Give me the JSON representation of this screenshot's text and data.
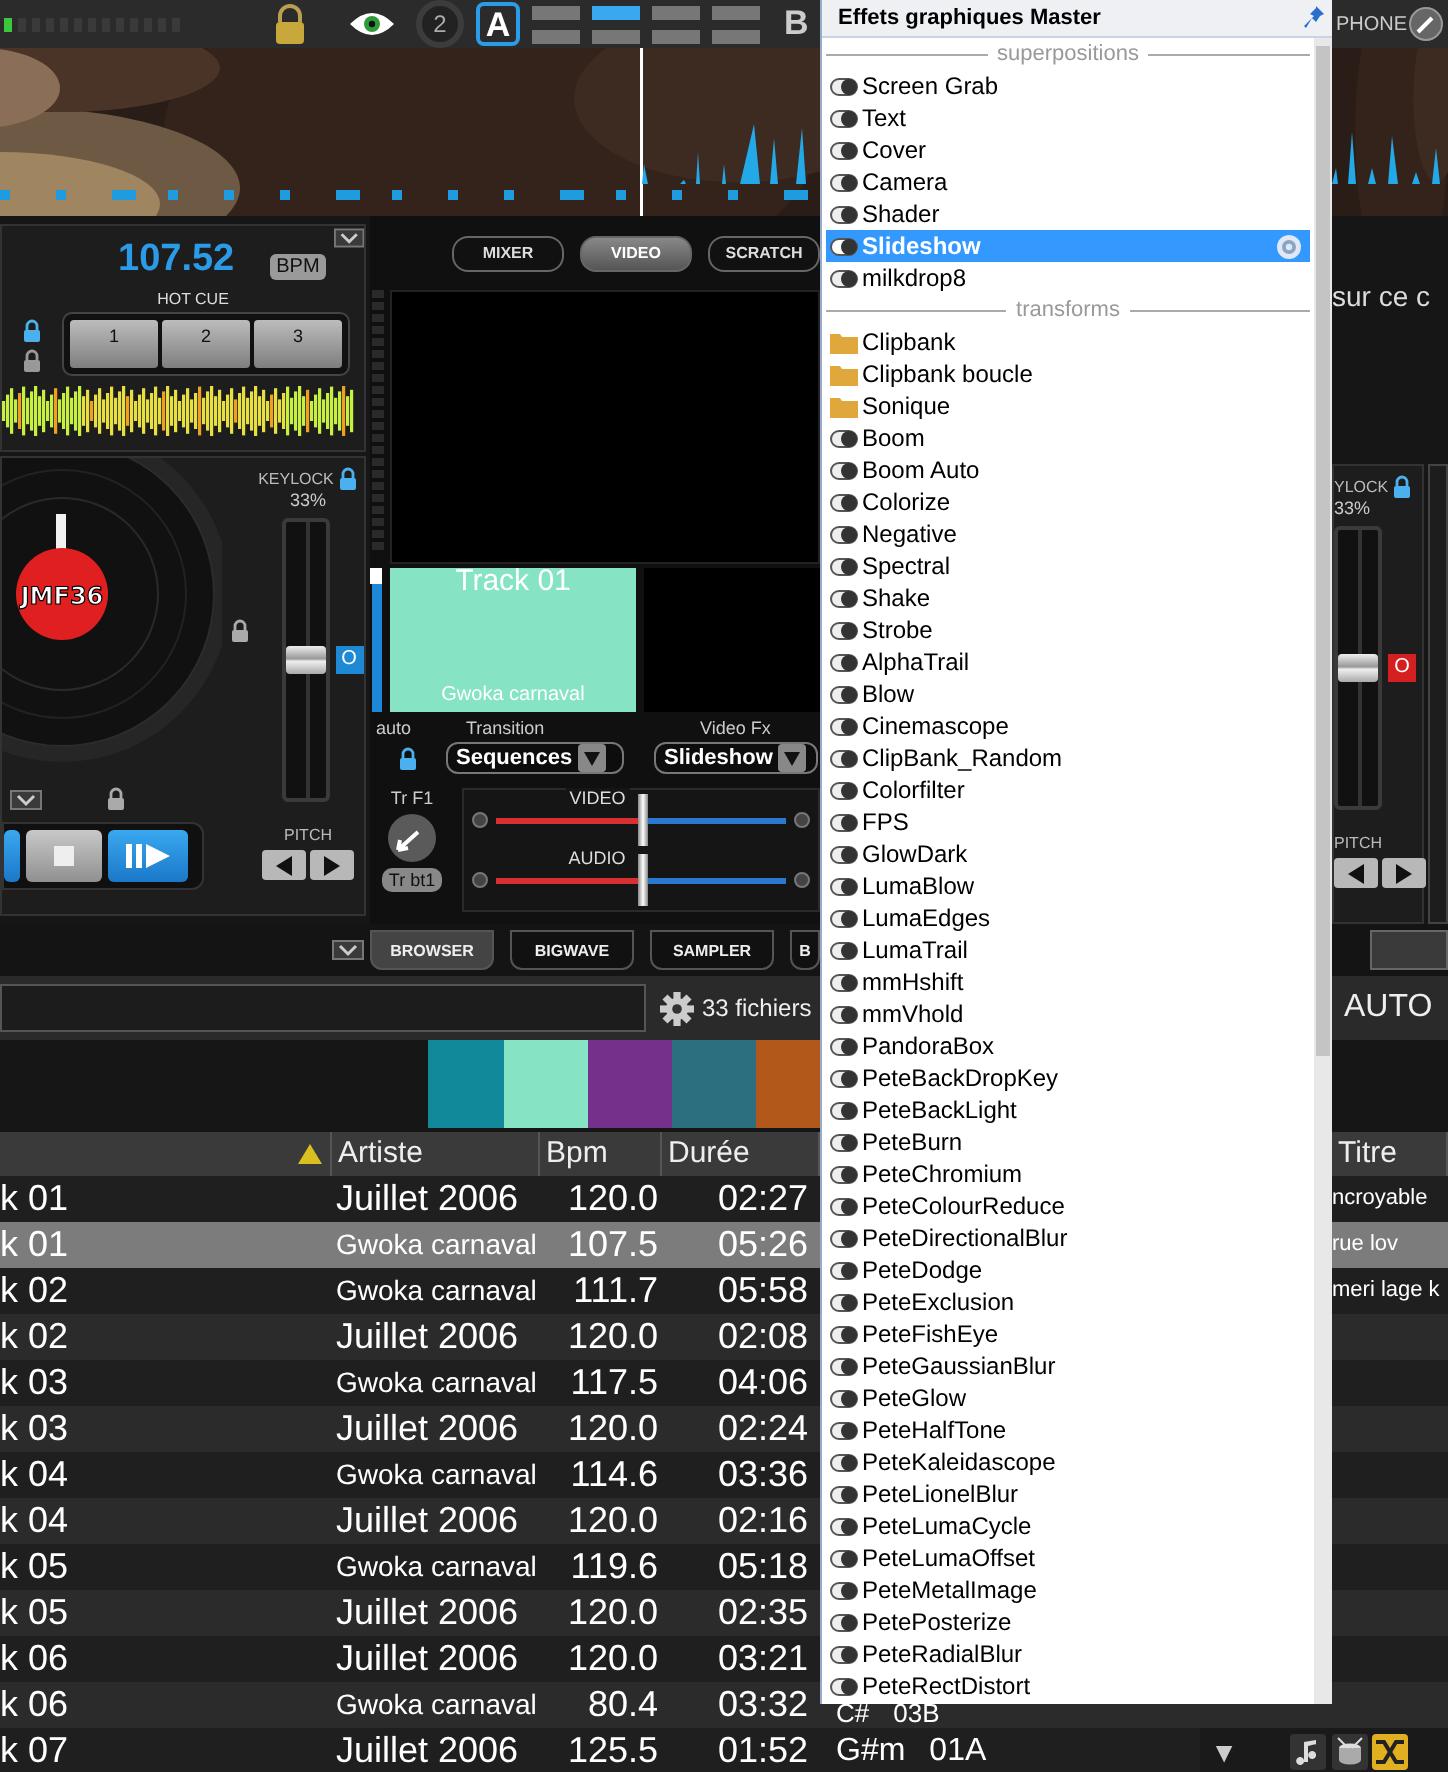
{
  "top_bar": {
    "deck_count": "2",
    "active_deck": "A",
    "other_deck": "B",
    "layouts": [
      {
        "selected": false
      },
      {
        "selected": true
      },
      {
        "selected": false
      },
      {
        "selected": false
      }
    ],
    "output_label": "PHONE"
  },
  "left_deck": {
    "bpm": "107.52",
    "bpm_button": "BPM",
    "hot_cue_label": "HOT CUE",
    "cue_buttons": [
      "1",
      "2",
      "3"
    ],
    "platter_label": "JMF36",
    "keylock_label": "KEYLOCK",
    "keylock_value": "33%",
    "pitch": {
      "level": 0.5
    },
    "sync_button": {
      "label": "O",
      "color": "#1e8ad6"
    },
    "pitch_label": "PITCH"
  },
  "video_panel": {
    "tabs": [
      {
        "label": "MIXER",
        "selected": false
      },
      {
        "label": "VIDEO",
        "selected": true
      },
      {
        "label": "SCRATCH",
        "selected": false
      }
    ],
    "thumbnails": [
      {
        "title": "Track 01",
        "subtitle": "Gwoka carnaval",
        "color": "#86e3c4"
      },
      {
        "color": "#000000"
      }
    ],
    "auto_label": "auto",
    "transition": {
      "label": "Transition",
      "value": "Sequences"
    },
    "video_fx": {
      "label": "Video Fx",
      "value": "Slideshow"
    },
    "knob_label": "Tr F1",
    "knob_button": "Tr bt1",
    "faders": [
      {
        "label": "VIDEO",
        "level": 0.5
      },
      {
        "label": "AUDIO",
        "level": 0.5
      }
    ]
  },
  "video_caption": "sur ce c",
  "right_deck": {
    "keylock_label": "YLOCK",
    "keylock_value": "33%",
    "pitch": {
      "level": 0.5
    },
    "sync_button": {
      "label": "O",
      "color": "#d42020"
    },
    "pitch_label": "PITCH"
  },
  "browser_tabs": [
    {
      "label": "BROWSER",
      "selected": true
    },
    {
      "label": "BIGWAVE",
      "selected": false
    },
    {
      "label": "SAMPLER",
      "selected": false
    },
    {
      "label": "B",
      "selected": false
    }
  ],
  "search": {
    "file_count": "33 fichiers"
  },
  "auto_label": "AUTO",
  "video_thumbnails": [
    {
      "color": "#12899a"
    },
    {
      "color": "#86e3c4"
    },
    {
      "color": "#74308a"
    },
    {
      "color": "#2c6f7e"
    },
    {
      "color": "#b2581a"
    }
  ],
  "table": {
    "columns": [
      {
        "sorted": true
      },
      {
        "label": "Artiste",
        "sorted": false
      },
      {
        "label": "Bpm",
        "sorted": false
      },
      {
        "label": "Durée",
        "sorted": false
      },
      {
        "label": "Titre",
        "sorted": false
      }
    ],
    "rows": [
      {
        "column_1": "k 01",
        "artiste": "Juillet 2006",
        "bpm": "120.0",
        "duree": "02:27",
        "titre": "ncroyable",
        "selected": false
      },
      {
        "column_1": "k 01",
        "artiste": "Gwoka carnaval",
        "bpm": "107.5",
        "duree": "05:26",
        "titre": "rue lov",
        "selected": true
      },
      {
        "column_1": "k 02",
        "artiste": "Gwoka carnaval",
        "bpm": "111.7",
        "duree": "05:58",
        "titre": "meri lage k",
        "selected": false
      },
      {
        "column_1": "k 02",
        "artiste": "Juillet 2006",
        "bpm": "120.0",
        "duree": "02:08",
        "selected": false
      },
      {
        "column_1": "k 03",
        "artiste": "Gwoka carnaval",
        "bpm": "117.5",
        "duree": "04:06",
        "selected": false
      },
      {
        "column_1": "k 03",
        "artiste": "Juillet 2006",
        "bpm": "120.0",
        "duree": "02:24",
        "selected": false
      },
      {
        "column_1": "k 04",
        "artiste": "Gwoka carnaval",
        "bpm": "114.6",
        "duree": "03:36",
        "selected": false
      },
      {
        "column_1": "k 04",
        "artiste": "Juillet 2006",
        "bpm": "120.0",
        "duree": "02:16",
        "selected": false
      },
      {
        "column_1": "k 05",
        "artiste": "Gwoka carnaval",
        "bpm": "119.6",
        "duree": "05:18",
        "selected": false
      },
      {
        "column_1": "k 05",
        "artiste": "Juillet 2006",
        "bpm": "120.0",
        "duree": "02:35",
        "selected": false
      },
      {
        "column_1": "k 06",
        "artiste": "Juillet 2006",
        "bpm": "120.0",
        "duree": "03:21",
        "selected": false
      },
      {
        "column_1": "k 06",
        "artiste": "Gwoka carnaval",
        "bpm": "80.4",
        "duree": "03:32",
        "column_5": "C#",
        "column_6": "03B",
        "selected": false
      },
      {
        "column_1": "k 07",
        "artiste": "Juillet 2006",
        "bpm": "125.5",
        "duree": "01:52",
        "column_5": "G#m",
        "column_6": "01A",
        "selected": false
      }
    ]
  },
  "effects_menu": {
    "title": "Effets graphiques Master",
    "sections": [
      {
        "title": "superpositions",
        "items": [
          {
            "kind": "toggle",
            "label": "Screen Grab",
            "selected": false
          },
          {
            "kind": "toggle",
            "label": "Text",
            "selected": false
          },
          {
            "kind": "toggle",
            "label": "Cover",
            "selected": false
          },
          {
            "kind": "toggle",
            "label": "Camera",
            "selected": false
          },
          {
            "kind": "toggle",
            "label": "Shader",
            "selected": false
          },
          {
            "kind": "toggle",
            "label": "Slideshow",
            "selected": true
          },
          {
            "kind": "toggle",
            "label": "milkdrop8",
            "selected": false
          }
        ]
      },
      {
        "title": "transforms",
        "items": [
          {
            "kind": "folder",
            "label": "Clipbank",
            "selected": false
          },
          {
            "kind": "folder",
            "label": "Clipbank boucle",
            "selected": false
          },
          {
            "kind": "folder",
            "label": "Sonique",
            "selected": false
          },
          {
            "kind": "toggle",
            "label": "Boom",
            "selected": false
          },
          {
            "kind": "toggle",
            "label": "Boom Auto",
            "selected": false
          },
          {
            "kind": "toggle",
            "label": "Colorize",
            "selected": false
          },
          {
            "kind": "toggle",
            "label": "Negative",
            "selected": false
          },
          {
            "kind": "toggle",
            "label": "Spectral",
            "selected": false
          },
          {
            "kind": "toggle",
            "label": "Shake",
            "selected": false
          },
          {
            "kind": "toggle",
            "label": "Strobe",
            "selected": false
          },
          {
            "kind": "toggle",
            "label": "AlphaTrail",
            "selected": false
          },
          {
            "kind": "toggle",
            "label": "Blow",
            "selected": false
          },
          {
            "kind": "toggle",
            "label": "Cinemascope",
            "selected": false
          },
          {
            "kind": "toggle",
            "label": "ClipBank_Random",
            "selected": false
          },
          {
            "kind": "toggle",
            "label": "Colorfilter",
            "selected": false
          },
          {
            "kind": "toggle",
            "label": "FPS",
            "selected": false
          },
          {
            "kind": "toggle",
            "label": "GlowDark",
            "selected": false
          },
          {
            "kind": "toggle",
            "label": "LumaBlow",
            "selected": false
          },
          {
            "kind": "toggle",
            "label": "LumaEdges",
            "selected": false
          },
          {
            "kind": "toggle",
            "label": "LumaTrail",
            "selected": false
          },
          {
            "kind": "toggle",
            "label": "mmHshift",
            "selected": false
          },
          {
            "kind": "toggle",
            "label": "mmVhold",
            "selected": false
          },
          {
            "kind": "toggle",
            "label": "PandoraBox",
            "selected": false
          },
          {
            "kind": "toggle",
            "label": "PeteBackDropKey",
            "selected": false
          },
          {
            "kind": "toggle",
            "label": "PeteBackLight",
            "selected": false
          },
          {
            "kind": "toggle",
            "label": "PeteBurn",
            "selected": false
          },
          {
            "kind": "toggle",
            "label": "PeteChromium",
            "selected": false
          },
          {
            "kind": "toggle",
            "label": "PeteColourReduce",
            "selected": false
          },
          {
            "kind": "toggle",
            "label": "PeteDirectionalBlur",
            "selected": false
          },
          {
            "kind": "toggle",
            "label": "PeteDodge",
            "selected": false
          },
          {
            "kind": "toggle",
            "label": "PeteExclusion",
            "selected": false
          },
          {
            "kind": "toggle",
            "label": "PeteFishEye",
            "selected": false
          },
          {
            "kind": "toggle",
            "label": "PeteGaussianBlur",
            "selected": false
          },
          {
            "kind": "toggle",
            "label": "PeteGlow",
            "selected": false
          },
          {
            "kind": "toggle",
            "label": "PeteHalfTone",
            "selected": false
          },
          {
            "kind": "toggle",
            "label": "PeteKaleidascope",
            "selected": false
          },
          {
            "kind": "toggle",
            "label": "PeteLionelBlur",
            "selected": false
          },
          {
            "kind": "toggle",
            "label": "PeteLumaCycle",
            "selected": false
          },
          {
            "kind": "toggle",
            "label": "PeteLumaOffset",
            "selected": false
          },
          {
            "kind": "toggle",
            "label": "PeteMetalImage",
            "selected": false
          },
          {
            "kind": "toggle",
            "label": "PetePosterize",
            "selected": false
          },
          {
            "kind": "toggle",
            "label": "PeteRadialBlur",
            "selected": false
          },
          {
            "kind": "toggle",
            "label": "PeteRectDistort",
            "selected": false
          }
        ]
      }
    ]
  },
  "footer": {
    "dropdown": "▼"
  }
}
